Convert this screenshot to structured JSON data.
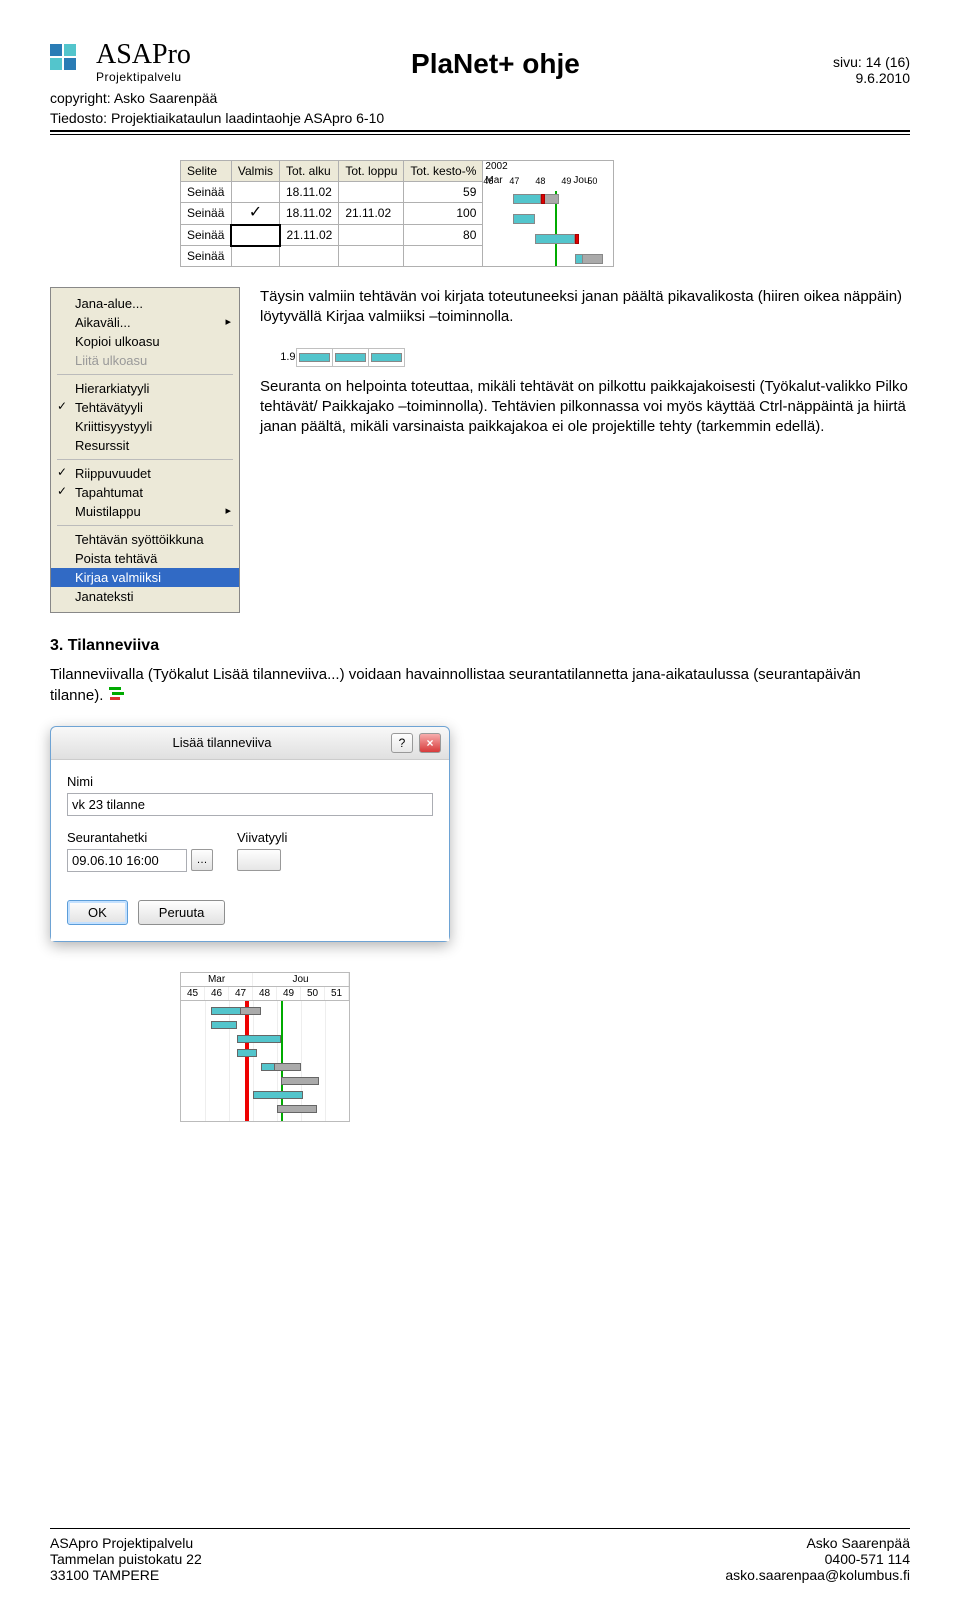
{
  "brand": {
    "name": "ASAPro",
    "sub": "Projektipalvelu"
  },
  "header": {
    "title": "PlaNet+ ohje",
    "page_label": "sivu: 14 (16)",
    "date": "9.6.2010",
    "copyright": "copyright: Asko Saarenpää",
    "file_line": "Tiedosto: Projektiaikataulun laadintaohje ASApro 6-10"
  },
  "grid": {
    "headers": [
      "Selite",
      "Valmis",
      "Tot. alku",
      "Tot. loppu",
      "Tot. kesto-%"
    ],
    "year": "2002",
    "months": [
      "Mar",
      "Jou"
    ],
    "weeks": [
      "46",
      "47",
      "48",
      "49",
      "50"
    ],
    "rows": [
      {
        "selite": "Seinää",
        "valmis": "",
        "alku": "18.11.02",
        "loppu": "",
        "pct": "59"
      },
      {
        "selite": "Seinää",
        "valmis": "✓",
        "alku": "18.11.02",
        "loppu": "21.11.02",
        "pct": "100"
      },
      {
        "selite": "Seinää",
        "valmis": "",
        "alku": "21.11.02",
        "loppu": "",
        "pct": "80"
      },
      {
        "selite": "Seinää",
        "valmis": "",
        "alku": "",
        "loppu": "",
        "pct": ""
      }
    ]
  },
  "menu": {
    "items": [
      {
        "label": "Jana-alue...",
        "checked": false,
        "arrow": false,
        "disabled": false
      },
      {
        "label": "Aikaväli...",
        "checked": false,
        "arrow": true,
        "disabled": false
      },
      {
        "label": "Kopioi ulkoasu",
        "checked": false,
        "arrow": false,
        "disabled": false
      },
      {
        "label": "Liitä ulkoasu",
        "checked": false,
        "arrow": false,
        "disabled": true
      },
      {
        "sep": true
      },
      {
        "label": "Hierarkiatyyli",
        "checked": false,
        "arrow": false,
        "disabled": false
      },
      {
        "label": "Tehtävätyyli",
        "checked": true,
        "arrow": false,
        "disabled": false
      },
      {
        "label": "Kriittisyystyyli",
        "checked": false,
        "arrow": false,
        "disabled": false
      },
      {
        "label": "Resurssit",
        "checked": false,
        "arrow": false,
        "disabled": false
      },
      {
        "sep": true
      },
      {
        "label": "Riippuvuudet",
        "checked": true,
        "arrow": false,
        "disabled": false
      },
      {
        "label": "Tapahtumat",
        "checked": true,
        "arrow": false,
        "disabled": false
      },
      {
        "label": "Muistilappu",
        "checked": false,
        "arrow": true,
        "disabled": false
      },
      {
        "sep": true
      },
      {
        "label": "Tehtävän syöttöikkuna",
        "checked": false,
        "arrow": false,
        "disabled": false
      },
      {
        "label": "Poista tehtävä",
        "checked": false,
        "arrow": false,
        "disabled": false
      },
      {
        "label": "Kirjaa valmiiksi",
        "checked": false,
        "arrow": false,
        "disabled": false,
        "selected": true
      },
      {
        "label": "Janateksti",
        "checked": false,
        "arrow": false,
        "disabled": false
      }
    ]
  },
  "para1": "Täysin valmiin tehtävän voi kirjata toteutuneeksi janan päältä pikavalikosta (hiiren oikea näppäin) löytyvällä Kirjaa valmiiksi –toiminnolla.",
  "sg_label": "1.9",
  "para2": "Seuranta on helpointa toteuttaa, mikäli tehtävät on pilkottu paikkajakoisesti (Työkalut-valikko Pilko tehtävät/ Paikkajako –toiminnolla). Tehtävien pilkonnassa voi myös käyttää Ctrl-näppäintä ja hiirtä janan päältä, mikäli varsinaista paikkajakoa ei ole projektille tehty (tarkemmin edellä).",
  "section3": {
    "title": "3. Tilanneviiva",
    "text1": "Tilanneviivalla (Työkalut Lisää tilanneviiva...) voidaan havainnollistaa seurantatilannetta jana-aikataulussa (seurantapäivän tilanne)."
  },
  "dialog": {
    "title": "Lisää tilanneviiva",
    "name_label": "Nimi",
    "name_value": "vk 23 tilanne",
    "dt_label": "Seurantahetki",
    "dt_value": "09.06.10 16:00",
    "style_label": "Viivatyyli",
    "ok": "OK",
    "cancel": "Peruuta"
  },
  "bottom_gantt": {
    "months": [
      "Mar",
      "Jou"
    ],
    "weeks": [
      "45",
      "46",
      "47",
      "48",
      "49",
      "50",
      "51"
    ]
  },
  "footer": {
    "left1": "ASApro Projektipalvelu",
    "left2": "Tammelan puistokatu 22",
    "left3": "33100 TAMPERE",
    "right1": "Asko Saarenpää",
    "right2": "0400-571 114",
    "right3": "asko.saarenpaa@kolumbus.fi"
  }
}
